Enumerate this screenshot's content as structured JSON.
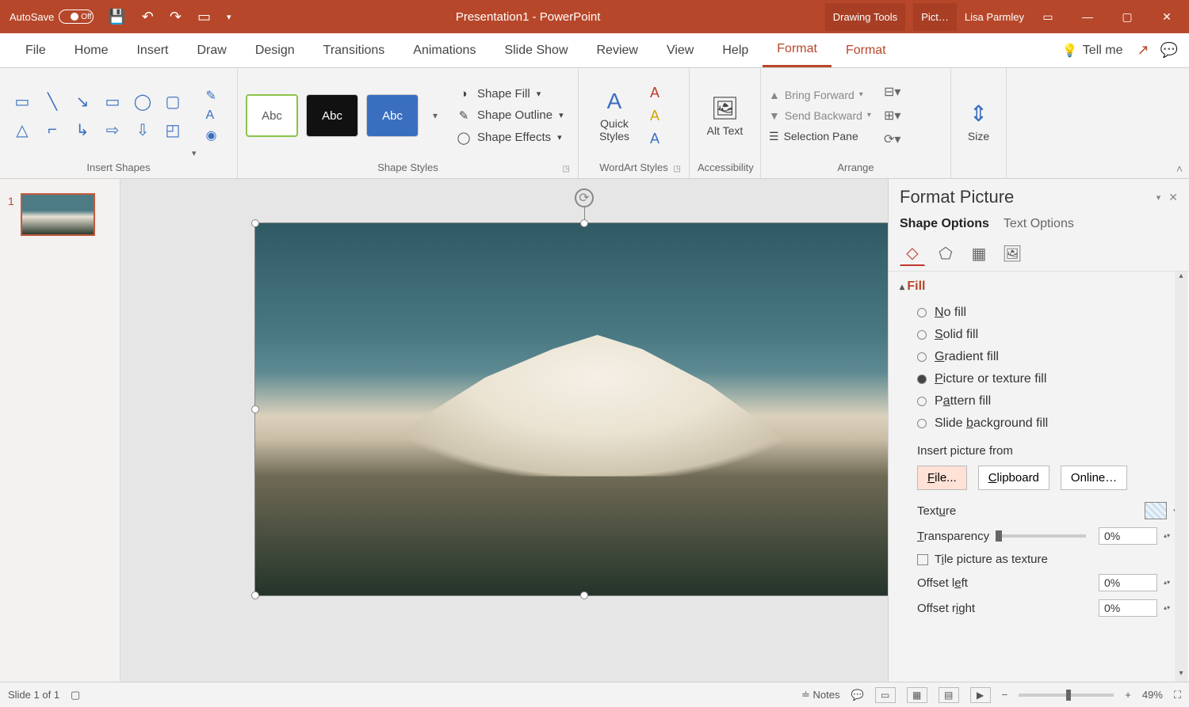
{
  "titlebar": {
    "autosave_label": "AutoSave",
    "autosave_state": "Off",
    "doc_title": "Presentation1  -  PowerPoint",
    "context1": "Drawing Tools",
    "context2": "Pict…",
    "user": "Lisa Parmley"
  },
  "tabs": {
    "items": [
      "File",
      "Home",
      "Insert",
      "Draw",
      "Design",
      "Transitions",
      "Animations",
      "Slide Show",
      "Review",
      "View",
      "Help",
      "Format",
      "Format"
    ],
    "active_index": 11,
    "tellme": "Tell me"
  },
  "ribbon": {
    "insert_shapes": "Insert Shapes",
    "shape_styles": "Shape Styles",
    "wordart_styles": "WordArt Styles",
    "accessibility": "Accessibility",
    "arrange": "Arrange",
    "size": "Size",
    "abc": "Abc",
    "shape_fill": "Shape Fill",
    "shape_outline": "Shape Outline",
    "shape_effects": "Shape Effects",
    "quick_styles": "Quick Styles",
    "alt_text": "Alt Text",
    "bring_forward": "Bring Forward",
    "send_backward": "Send Backward",
    "selection_pane": "Selection Pane"
  },
  "thumb": {
    "num": "1"
  },
  "pane": {
    "title": "Format Picture",
    "shape_options": "Shape Options",
    "text_options": "Text Options",
    "fill": "Fill",
    "no_fill": "No fill",
    "solid_fill": "Solid fill",
    "gradient_fill": "Gradient fill",
    "picture_fill": "Picture or texture fill",
    "pattern_fill": "Pattern fill",
    "slide_bg_fill": "Slide background fill",
    "insert_from": "Insert picture from",
    "file_btn": "File...",
    "clipboard_btn": "Clipboard",
    "online_btn": "Online…",
    "texture": "Texture",
    "transparency": "Transparency",
    "transparency_val": "0%",
    "tile": "Tile picture as texture",
    "offset_left": "Offset left",
    "offset_left_val": "0%",
    "offset_right": "Offset right",
    "offset_right_val": "0%"
  },
  "status": {
    "slide": "Slide 1 of 1",
    "notes": "Notes",
    "zoom": "49%"
  }
}
